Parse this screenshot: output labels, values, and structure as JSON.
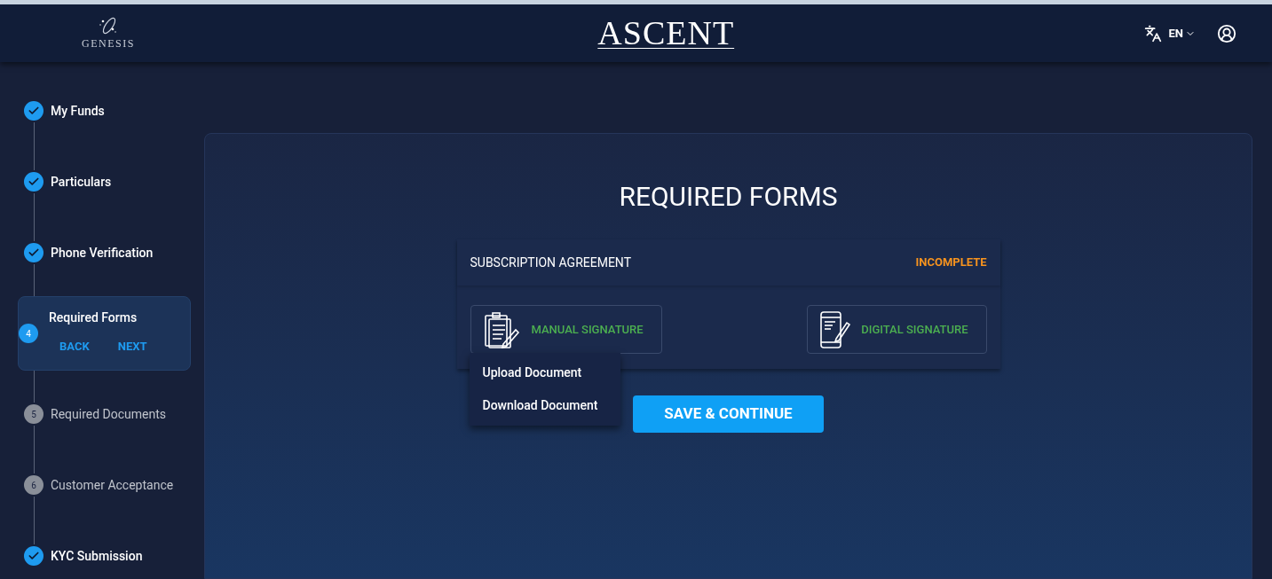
{
  "header": {
    "logo_text": "GENESIS",
    "title": "ASCENT",
    "language": "EN"
  },
  "steps": [
    {
      "label": "My Funds",
      "kind": "done"
    },
    {
      "label": "Particulars",
      "kind": "done"
    },
    {
      "label": "Phone Verification",
      "kind": "done"
    },
    {
      "label": "Required Forms",
      "kind": "active",
      "number": "4",
      "back": "BACK",
      "next": "NEXT"
    },
    {
      "label": "Required Documents",
      "kind": "pending",
      "number": "5"
    },
    {
      "label": "Customer Acceptance",
      "kind": "pending",
      "number": "6"
    },
    {
      "label": "KYC Submission",
      "kind": "done"
    }
  ],
  "main": {
    "heading": "REQUIRED FORMS",
    "form": {
      "name": "SUBSCRIPTION AGREEMENT",
      "status": "INCOMPLETE",
      "color": "#f7931e"
    },
    "options": [
      {
        "label": "MANUAL SIGNATURE",
        "kind": "manual"
      },
      {
        "label": "DIGITAL SIGNATURE",
        "kind": "digital"
      }
    ],
    "menu": [
      {
        "label": "Upload Document"
      },
      {
        "label": "Download Document"
      }
    ],
    "save_button": "SAVE & CONTINUE"
  }
}
